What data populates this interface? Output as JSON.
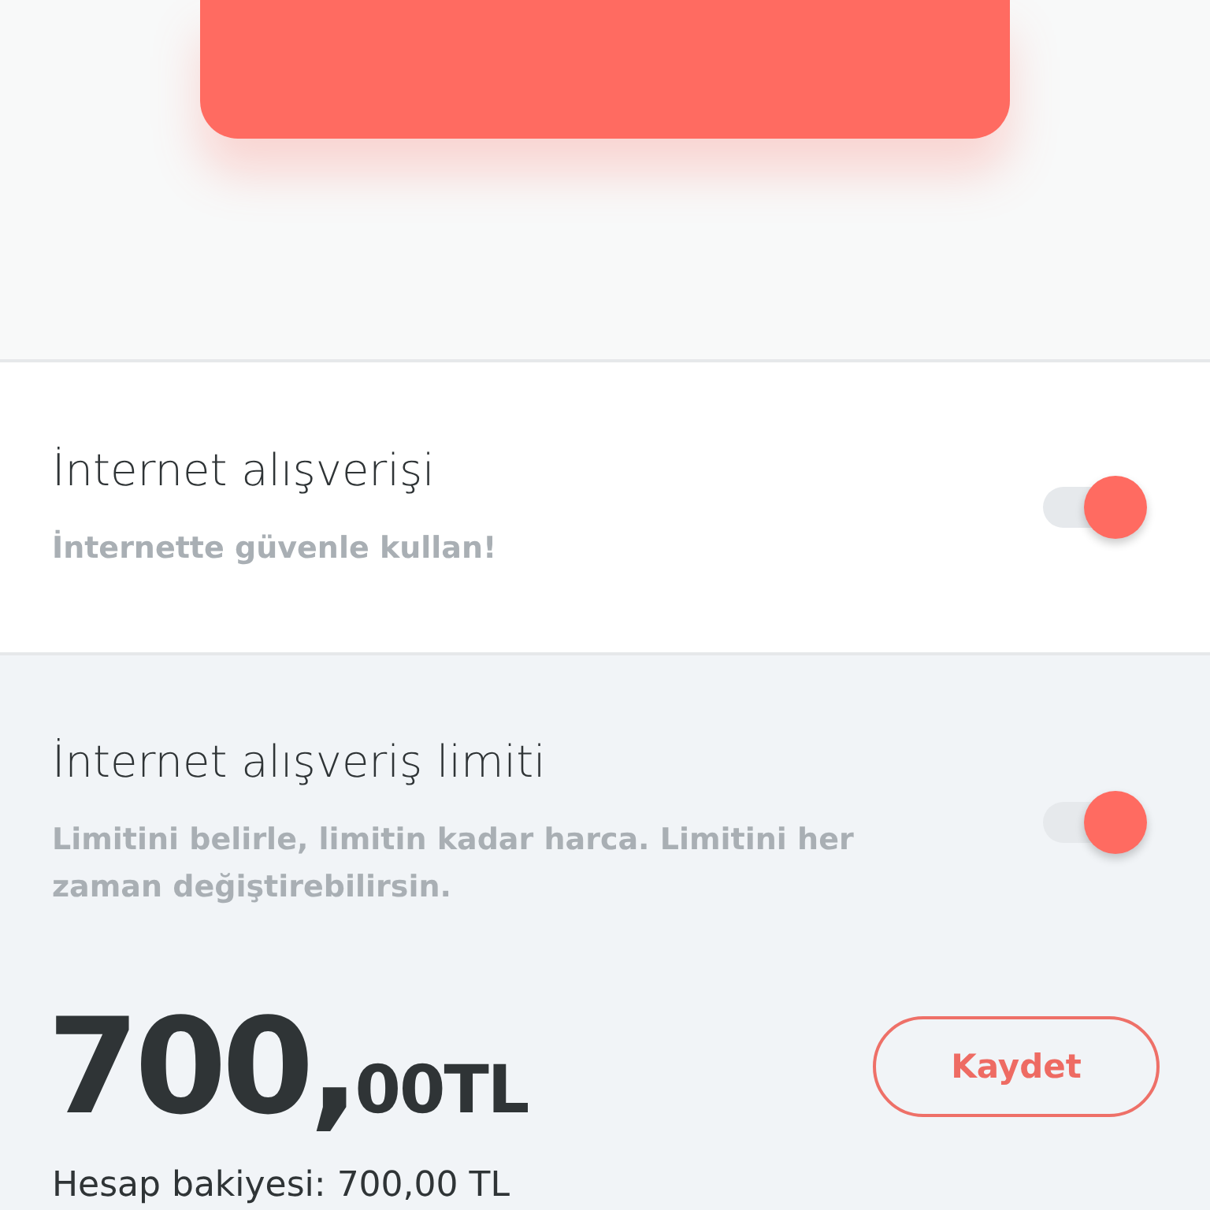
{
  "settings": [
    {
      "title": "İnternet alışverişi",
      "description": "İnternette güvenle kullan!",
      "on": true
    },
    {
      "title": "İnternet alışveriş limiti",
      "description": "Limitini belirle, limitin kadar harca. Limitini her zaman değiştirebilirsin.",
      "on": true
    }
  ],
  "limit": {
    "amount": "700,",
    "amount_fraction": "00TL",
    "save_button": "Kaydet",
    "balance": "Hesap bakiyesi: 700,00 TL"
  }
}
